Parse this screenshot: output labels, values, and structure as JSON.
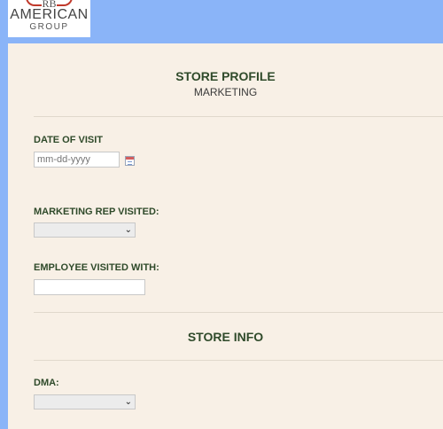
{
  "logo": {
    "line_rb": "RB",
    "line_1": "AMERICAN",
    "line_2": "GROUP"
  },
  "form": {
    "title": "STORE PROFILE",
    "subtitle": "MARKETING",
    "date_of_visit": {
      "label": "DATE OF VISIT",
      "placeholder": "mm-dd-yyyy"
    },
    "marketing_rep": {
      "label": "MARKETING REP VISITED:",
      "value": ""
    },
    "employee_visited": {
      "label": "EMPLOYEE VISITED WITH:",
      "value": ""
    },
    "store_info_title": "STORE INFO",
    "dma": {
      "label": "DMA:",
      "value": ""
    }
  }
}
